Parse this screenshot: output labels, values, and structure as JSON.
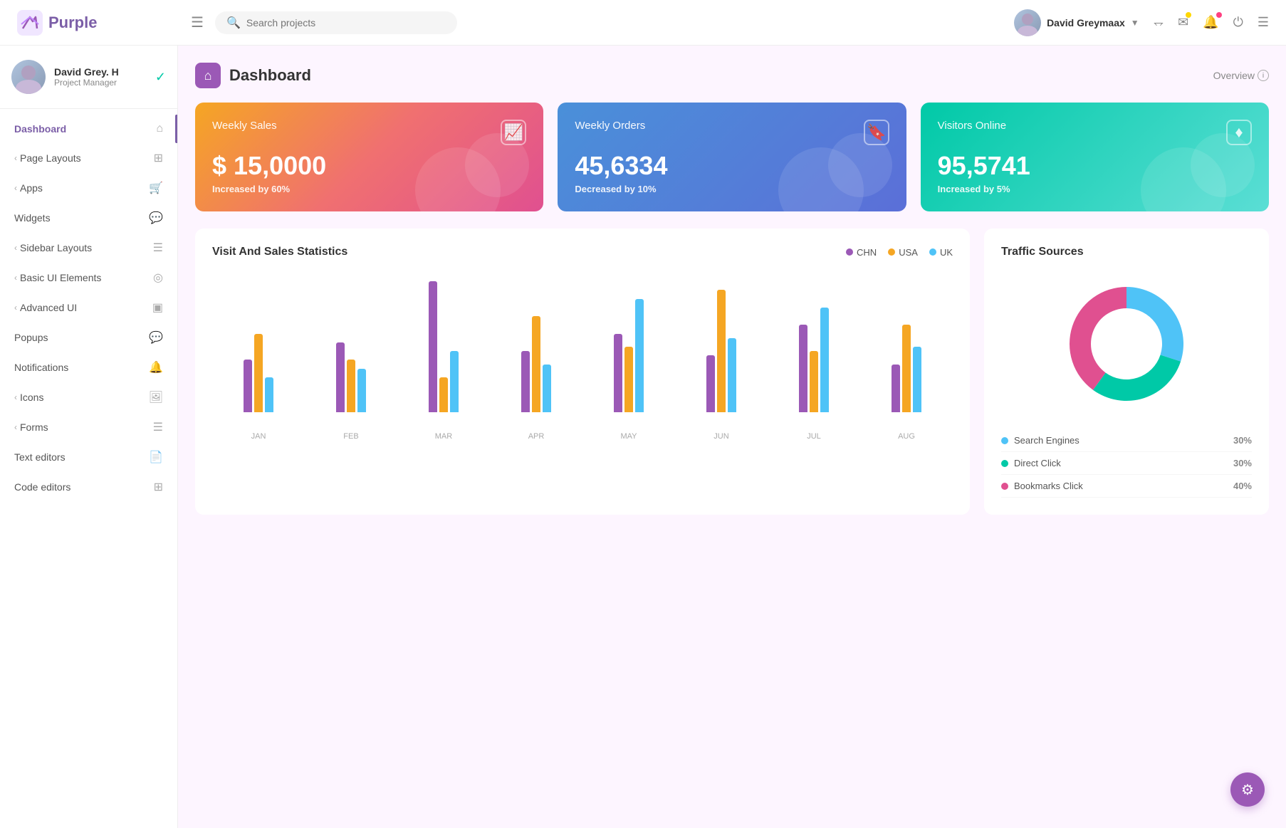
{
  "app": {
    "name": "Purple",
    "logo_alt": "Purple logo"
  },
  "header": {
    "menu_icon": "☰",
    "search_placeholder": "Search projects",
    "user_name": "David Greymaax",
    "user_dropdown": "▾",
    "icons": {
      "fullscreen": "⤢",
      "mail": "✉",
      "bell": "🔔",
      "power": "⏻",
      "list": "☰"
    }
  },
  "sidebar": {
    "profile": {
      "name": "David Grey. H",
      "role": "Project Manager",
      "check_icon": "✓"
    },
    "nav_items": [
      {
        "label": "Dashboard",
        "icon": "⌂",
        "active": true,
        "has_chevron": false
      },
      {
        "label": "Page Layouts",
        "icon": "⊞",
        "active": false,
        "has_chevron": true
      },
      {
        "label": "Apps",
        "icon": "🛒",
        "active": false,
        "has_chevron": true
      },
      {
        "label": "Widgets",
        "icon": "💬",
        "active": false,
        "has_chevron": false
      },
      {
        "label": "Sidebar Layouts",
        "icon": "☰",
        "active": false,
        "has_chevron": true
      },
      {
        "label": "Basic UI Elements",
        "icon": "◎",
        "active": false,
        "has_chevron": true
      },
      {
        "label": "Advanced UI",
        "icon": "▣",
        "active": false,
        "has_chevron": true
      },
      {
        "label": "Popups",
        "icon": "💬",
        "active": false,
        "has_chevron": false
      },
      {
        "label": "Notifications",
        "icon": "🔔",
        "active": false,
        "has_chevron": false
      },
      {
        "label": "Icons",
        "icon": "🖼",
        "active": false,
        "has_chevron": true
      },
      {
        "label": "Forms",
        "icon": "☰",
        "active": false,
        "has_chevron": true
      },
      {
        "label": "Text editors",
        "icon": "📄",
        "active": false,
        "has_chevron": false
      },
      {
        "label": "Code editors",
        "icon": "⊞",
        "active": false,
        "has_chevron": false
      }
    ]
  },
  "dashboard": {
    "title": "Dashboard",
    "overview_label": "Overview",
    "stat_cards": [
      {
        "label": "Weekly Sales",
        "value": "$ 15,0000",
        "change": "Increased by 60%",
        "icon": "📈",
        "color": "orange"
      },
      {
        "label": "Weekly Orders",
        "value": "45,6334",
        "change": "Decreased by 10%",
        "icon": "🔖",
        "color": "blue"
      },
      {
        "label": "Visitors Online",
        "value": "95,5741",
        "change": "Increased by 5%",
        "icon": "♦",
        "color": "teal"
      }
    ],
    "bar_chart": {
      "title": "Visit And Sales Statistics",
      "legend": [
        {
          "label": "CHN",
          "color": "#9b59b6"
        },
        {
          "label": "USA",
          "color": "#f5a623"
        },
        {
          "label": "UK",
          "color": "#4fc3f7"
        }
      ],
      "months": [
        "JAN",
        "FEB",
        "MAR",
        "APR",
        "MAY",
        "JUN",
        "JUL",
        "AUG"
      ],
      "data": [
        {
          "month": "JAN",
          "purple": 60,
          "orange": 90,
          "blue": 40
        },
        {
          "month": "FEB",
          "purple": 80,
          "orange": 60,
          "blue": 50
        },
        {
          "month": "MAR",
          "purple": 150,
          "orange": 40,
          "blue": 70
        },
        {
          "month": "APR",
          "purple": 70,
          "orange": 110,
          "blue": 55
        },
        {
          "month": "MAY",
          "purple": 90,
          "orange": 75,
          "blue": 130
        },
        {
          "month": "JUN",
          "purple": 65,
          "orange": 140,
          "blue": 85
        },
        {
          "month": "JUL",
          "purple": 100,
          "orange": 70,
          "blue": 120
        },
        {
          "month": "AUG",
          "purple": 55,
          "orange": 100,
          "blue": 75
        }
      ]
    },
    "donut_chart": {
      "title": "Traffic Sources",
      "segments": [
        {
          "label": "Search Engines",
          "pct": 30,
          "color": "#4fc3f7",
          "start": 0
        },
        {
          "label": "Direct Click",
          "pct": 30,
          "color": "#00c9a7",
          "start": 108
        },
        {
          "label": "Bookmarks Click",
          "pct": 40,
          "color": "#e05090",
          "start": 216
        }
      ]
    }
  },
  "fab": {
    "icon": "⚙"
  }
}
